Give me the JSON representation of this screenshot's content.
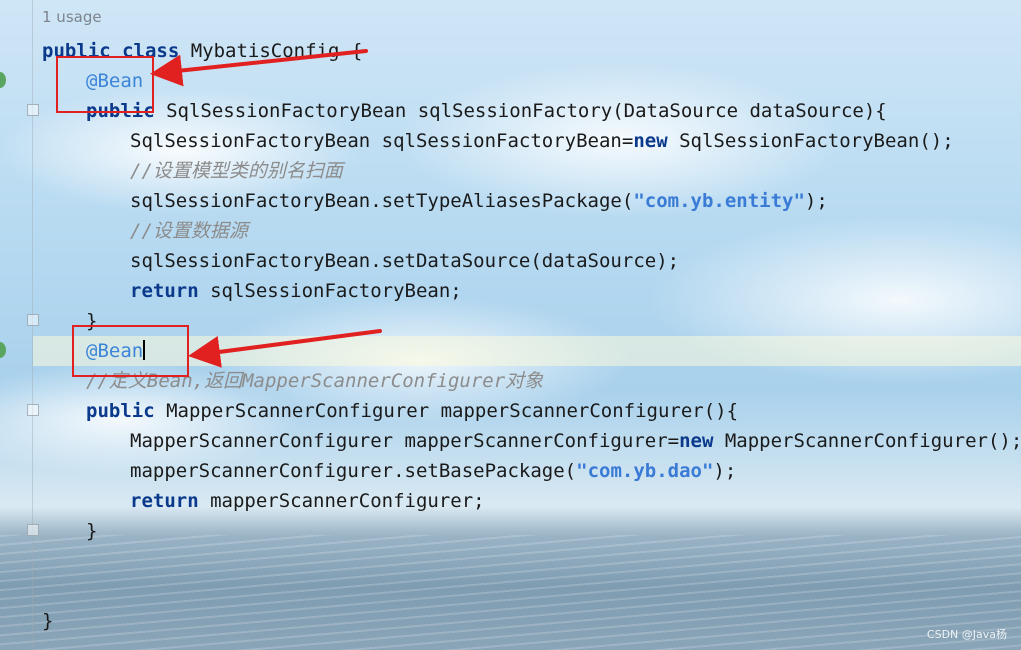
{
  "editor": {
    "usage_hint": "1 usage",
    "lines": [
      {
        "kw1": "public",
        "kw2": "class",
        "rest": " MybatisConfig {"
      },
      {
        "annotation": "@Bean"
      },
      {
        "kw": "public",
        "rest": " SqlSessionFactoryBean sqlSessionFactory(DataSource dataSource){"
      },
      {
        "pre": "SqlSessionFactoryBean sqlSessionFactoryBean=",
        "kw": "new",
        "post": " SqlSessionFactoryBean();"
      },
      {
        "comment": "//设置模型类的别名扫面"
      },
      {
        "pre": "sqlSessionFactoryBean.setTypeAliasesPackage(",
        "str": "\"com.yb.entity\"",
        "post": ");"
      },
      {
        "comment": "//设置数据源"
      },
      {
        "text": "sqlSessionFactoryBean.setDataSource(dataSource);"
      },
      {
        "kw": "return",
        "rest": " sqlSessionFactoryBean;"
      },
      {
        "text": "}"
      },
      {
        "annotation": "@Bean"
      },
      {
        "comment": "//定义Bean,返回MapperScannerConfigurer对象"
      },
      {
        "kw": "public",
        "rest": " MapperScannerConfigurer mapperScannerConfigurer(){"
      },
      {
        "pre": "MapperScannerConfigurer mapperScannerConfigurer=",
        "kw": "new",
        "post": " MapperScannerConfigurer();"
      },
      {
        "pre": "mapperScannerConfigurer.setBasePackage(",
        "str": "\"com.yb.dao\"",
        "post": ");"
      },
      {
        "kw": "return",
        "rest": " mapperScannerConfigurer;"
      },
      {
        "text": "}"
      },
      {
        "text": "}"
      }
    ]
  },
  "watermark": "CSDN @Java杨",
  "colors": {
    "keyword": "#0b3a8c",
    "annotation": "#3b84d8",
    "string": "#3a7bd5",
    "comment": "#8c8c8c",
    "highlight_box": "#e12020"
  }
}
